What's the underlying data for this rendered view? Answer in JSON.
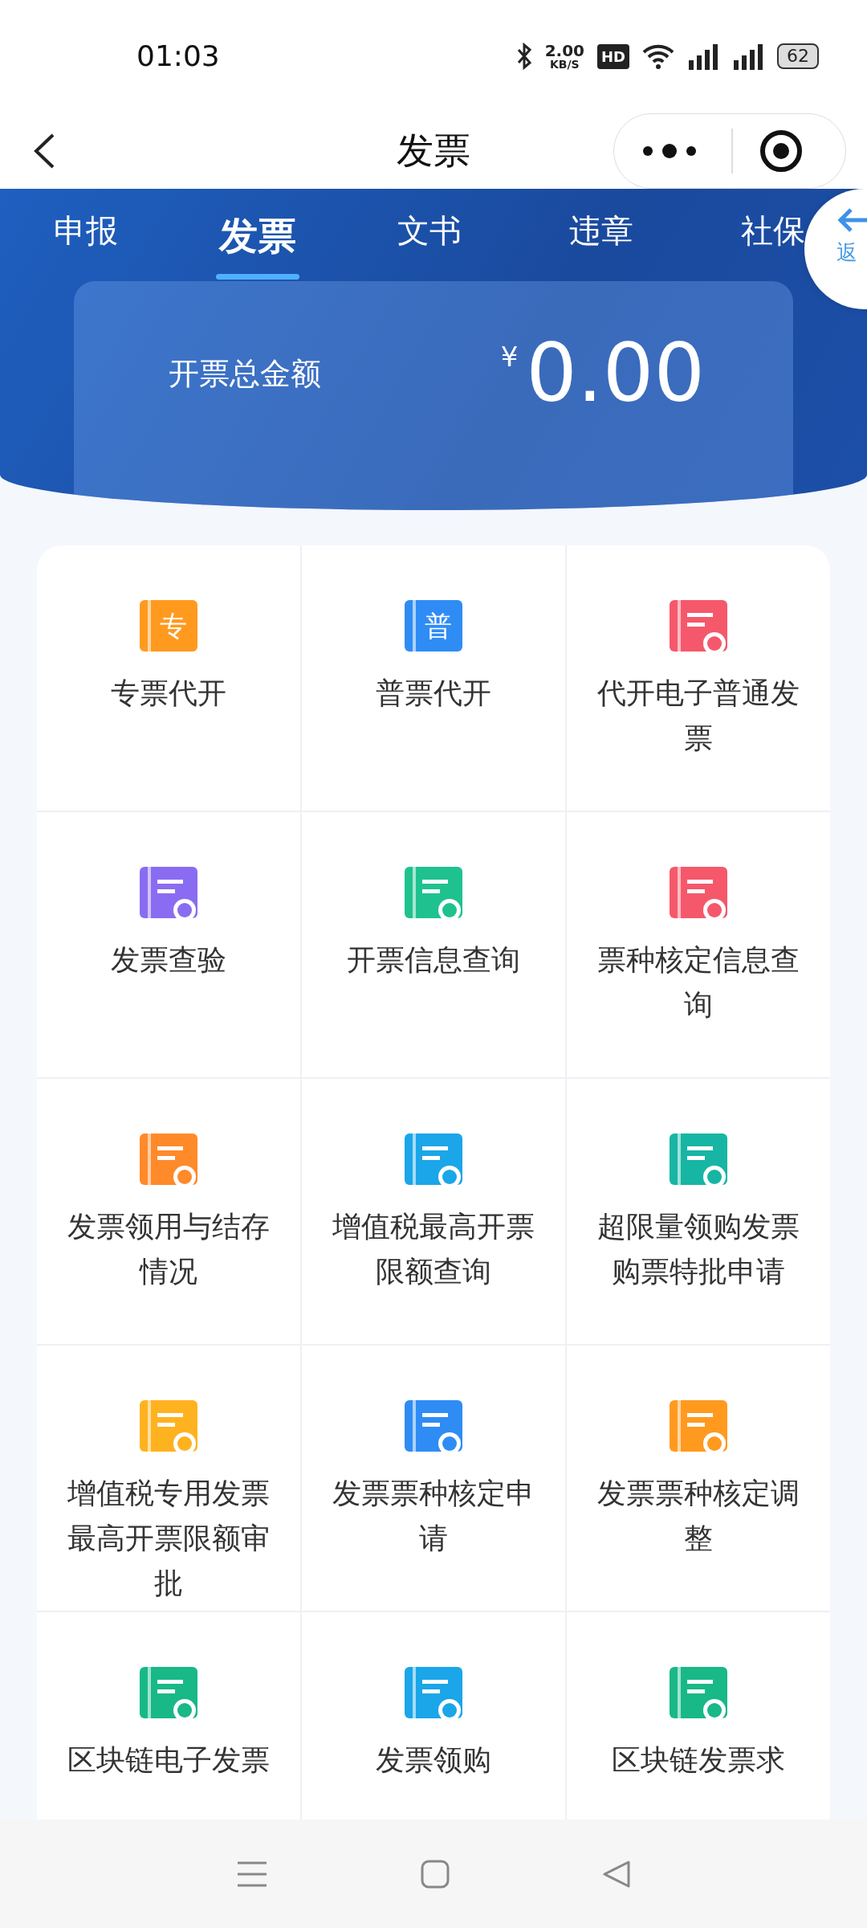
{
  "status_bar": {
    "time": "01:03",
    "speed": "2.00",
    "speed_unit": "KB/S",
    "hd": "HD",
    "battery": "62"
  },
  "header": {
    "title": "发票"
  },
  "tabs": [
    {
      "label": "申报",
      "selected": false
    },
    {
      "label": "发票",
      "selected": true
    },
    {
      "label": "文书",
      "selected": false
    },
    {
      "label": "违章",
      "selected": false
    },
    {
      "label": "社保",
      "selected": false
    }
  ],
  "float_button": {
    "label": "返"
  },
  "summary": {
    "label": "开票总金额",
    "currency": "¥",
    "amount": "0.00"
  },
  "services": [
    {
      "label": "专票代开",
      "badge": "专",
      "color": "#ff9a1f"
    },
    {
      "label": "普票代开",
      "badge": "普",
      "color": "#2f8cf5"
    },
    {
      "label": "代开电子普通发票",
      "color": "#f5586b"
    },
    {
      "label": "发票查验",
      "color": "#8a6cf2"
    },
    {
      "label": "开票信息查询",
      "color": "#1fc28f"
    },
    {
      "label": "票种核定信息查询",
      "color": "#f5586b"
    },
    {
      "label": "发票领用与结存情况",
      "color": "#ff8a2a"
    },
    {
      "label": "增值税最高开票限额查询",
      "color": "#1aa6e8"
    },
    {
      "label": "超限量领购发票购票特批申请",
      "color": "#17b5a3"
    },
    {
      "label": "增值税专用发票最高开票限额审批",
      "color": "#ffb21f"
    },
    {
      "label": "发票票种核定申请",
      "color": "#2f8cf5"
    },
    {
      "label": "发票票种核定调整",
      "color": "#ff9a1f"
    },
    {
      "label": "区块链电子发票",
      "color": "#18b887"
    },
    {
      "label": "发票领购",
      "color": "#1aa6e8"
    },
    {
      "label": "区块链发票求",
      "color": "#18b887"
    }
  ]
}
